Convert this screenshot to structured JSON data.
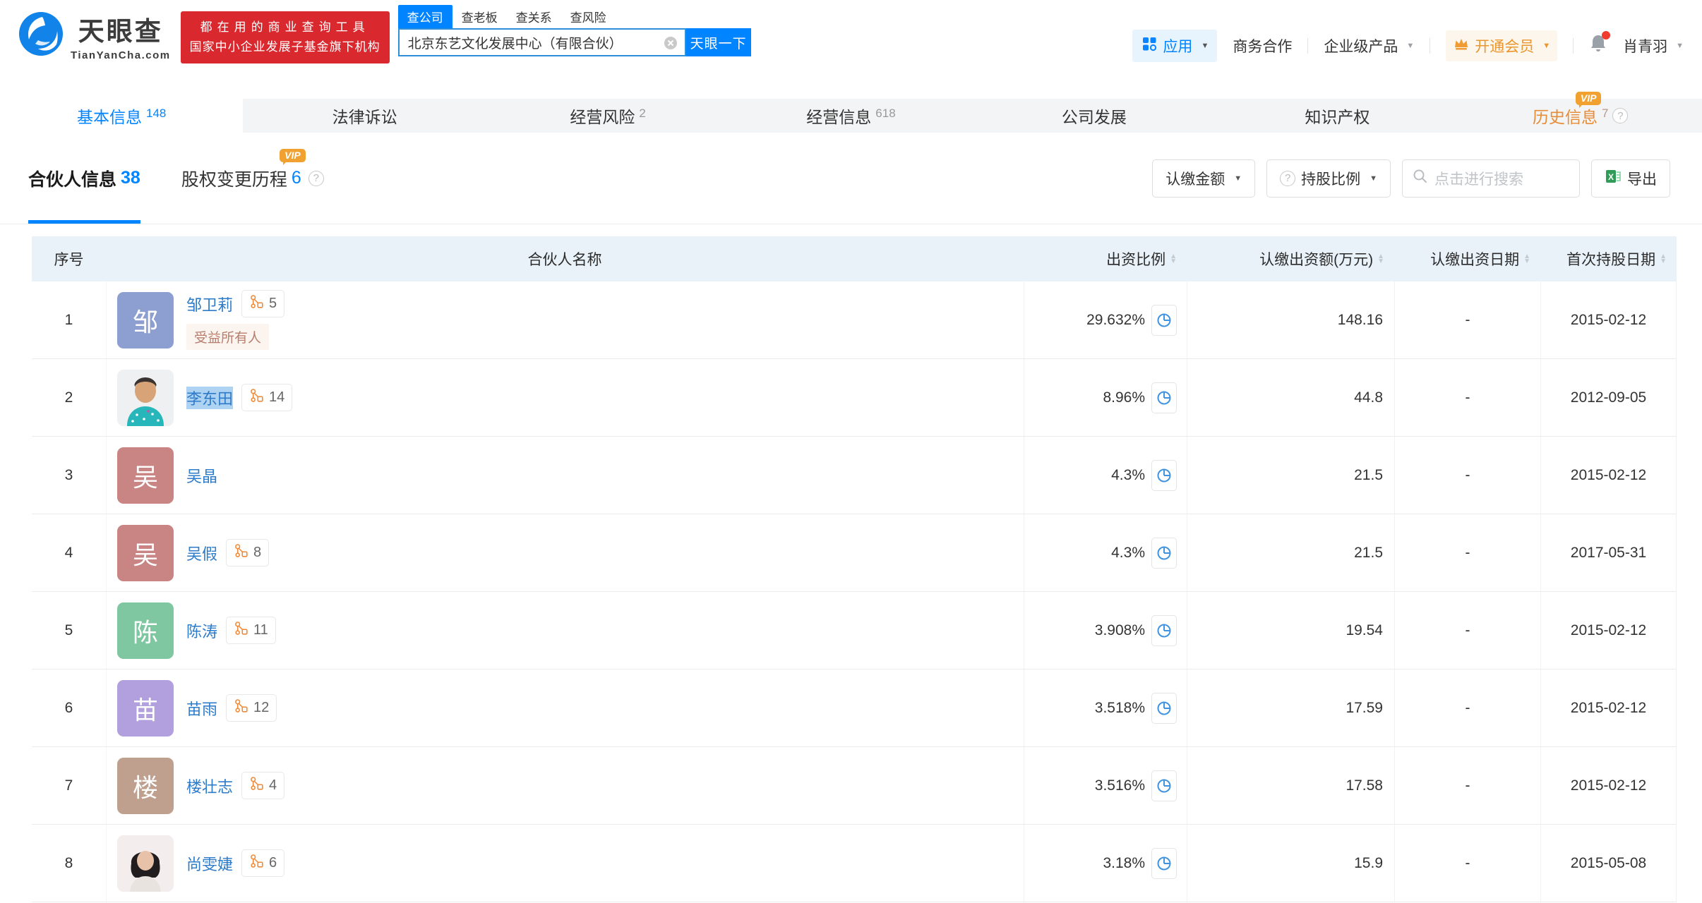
{
  "header": {
    "logo": {
      "brand": "天眼查",
      "domain": "TianYanCha.com"
    },
    "promo": {
      "line1": "都在用的商业查询工具",
      "line2": "国家中小企业发展子基金旗下机构"
    },
    "search": {
      "tabs": [
        {
          "label": "查公司",
          "active": true
        },
        {
          "label": "查老板",
          "active": false
        },
        {
          "label": "查关系",
          "active": false
        },
        {
          "label": "查风险",
          "active": false
        }
      ],
      "value": "北京东艺文化发展中心（有限合伙）",
      "button": "天眼一下"
    },
    "nav": {
      "apps": "应用",
      "cooperation": "商务合作",
      "enterprise": "企业级产品",
      "vip": "开通会员",
      "username": "肖青羽"
    }
  },
  "tabbar": {
    "tabs": [
      {
        "label": "基本信息",
        "count": "148",
        "active": true
      },
      {
        "label": "法律诉讼"
      },
      {
        "label": "经营风险",
        "count": "2"
      },
      {
        "label": "经营信息",
        "count": "618"
      },
      {
        "label": "公司发展"
      },
      {
        "label": "知识产权"
      },
      {
        "label": "历史信息",
        "count": "7",
        "orange": true,
        "vip": true,
        "help": true
      }
    ]
  },
  "subnav": {
    "tabs": [
      {
        "label": "合伙人信息",
        "count": "38",
        "active": true
      },
      {
        "label": "股权变更历程",
        "count": "6",
        "vip": true,
        "help": true
      }
    ],
    "filters": {
      "amount": "认缴金额",
      "ratio": "持股比例",
      "search_placeholder": "点击进行搜索",
      "export": "导出"
    },
    "vip_badge": "VIP"
  },
  "table": {
    "columns": [
      "序号",
      "合伙人名称",
      "出资比例",
      "认缴出资额(万元)",
      "认缴出资日期",
      "首次持股日期"
    ],
    "rows": [
      {
        "no": "1",
        "name": "邹卫莉",
        "avatar_type": "text",
        "avatar_text": "邹",
        "avatar_color": "#8d9ed0",
        "rel": "5",
        "tag": "受益所有人",
        "ratio": "29.632%",
        "amount": "148.16",
        "sub_date": "-",
        "first_date": "2015-02-12",
        "highlight": false
      },
      {
        "no": "2",
        "name": "李东田",
        "avatar_type": "man",
        "rel": "14",
        "ratio": "8.96%",
        "amount": "44.8",
        "sub_date": "-",
        "first_date": "2012-09-05",
        "highlight": true
      },
      {
        "no": "3",
        "name": "吴晶",
        "avatar_type": "text",
        "avatar_text": "吴",
        "avatar_color": "#c88583",
        "ratio": "4.3%",
        "amount": "21.5",
        "sub_date": "-",
        "first_date": "2015-02-12",
        "highlight": false
      },
      {
        "no": "4",
        "name": "吴假",
        "avatar_type": "text",
        "avatar_text": "吴",
        "avatar_color": "#c88583",
        "rel": "8",
        "ratio": "4.3%",
        "amount": "21.5",
        "sub_date": "-",
        "first_date": "2017-05-31",
        "highlight": false
      },
      {
        "no": "5",
        "name": "陈涛",
        "avatar_type": "text",
        "avatar_text": "陈",
        "avatar_color": "#7fc7a0",
        "rel": "11",
        "ratio": "3.908%",
        "amount": "19.54",
        "sub_date": "-",
        "first_date": "2015-02-12",
        "highlight": false
      },
      {
        "no": "6",
        "name": "苗雨",
        "avatar_type": "text",
        "avatar_text": "苗",
        "avatar_color": "#b29fde",
        "rel": "12",
        "ratio": "3.518%",
        "amount": "17.59",
        "sub_date": "-",
        "first_date": "2015-02-12",
        "highlight": false
      },
      {
        "no": "7",
        "name": "楼壮志",
        "avatar_type": "text",
        "avatar_text": "楼",
        "avatar_color": "#bfa08f",
        "rel": "4",
        "ratio": "3.516%",
        "amount": "17.58",
        "sub_date": "-",
        "first_date": "2015-02-12",
        "highlight": false
      },
      {
        "no": "8",
        "name": "尚雯婕",
        "avatar_type": "woman",
        "rel": "6",
        "ratio": "3.18%",
        "amount": "15.9",
        "sub_date": "-",
        "first_date": "2015-05-08",
        "highlight": false
      }
    ]
  }
}
